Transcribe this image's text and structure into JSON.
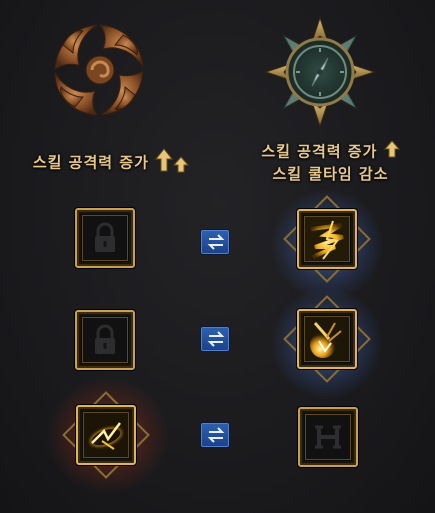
{
  "left_column": {
    "label": "스킬 공격력 증가",
    "emblem_icon": "bronze-swirl-emblem-icon",
    "arrow_icon": "double-up-arrow-icon"
  },
  "right_column": {
    "label_line1": "스킬 공격력 증가",
    "label_line2": "스킬 쿨타임 감소",
    "emblem_icon": "compass-emblem-icon",
    "arrow_icon": "up-arrow-icon"
  },
  "rows": [
    {
      "left": {
        "state": "locked",
        "icon": "lock-icon"
      },
      "swap_icon": "swap-arrows-icon",
      "right": {
        "state": "equipped",
        "icon": "lightning-slash-skill-icon",
        "aura": "blue"
      }
    },
    {
      "left": {
        "state": "locked",
        "icon": "lock-icon"
      },
      "swap_icon": "swap-arrows-icon",
      "right": {
        "state": "equipped",
        "icon": "explosion-strike-skill-icon",
        "aura": "blue"
      }
    },
    {
      "left": {
        "state": "equipped",
        "icon": "lightning-vortex-skill-icon",
        "aura": "red"
      },
      "swap_icon": "swap-arrows-icon",
      "right": {
        "state": "locked",
        "icon": "slot-bracket-icon"
      }
    }
  ],
  "colors": {
    "gold_text": "#e9c98a",
    "frame_gold": "#c9a052",
    "swap_blue": "#2c5fae",
    "blue_aura": "#5a8ce6",
    "red_aura": "#c85028"
  }
}
